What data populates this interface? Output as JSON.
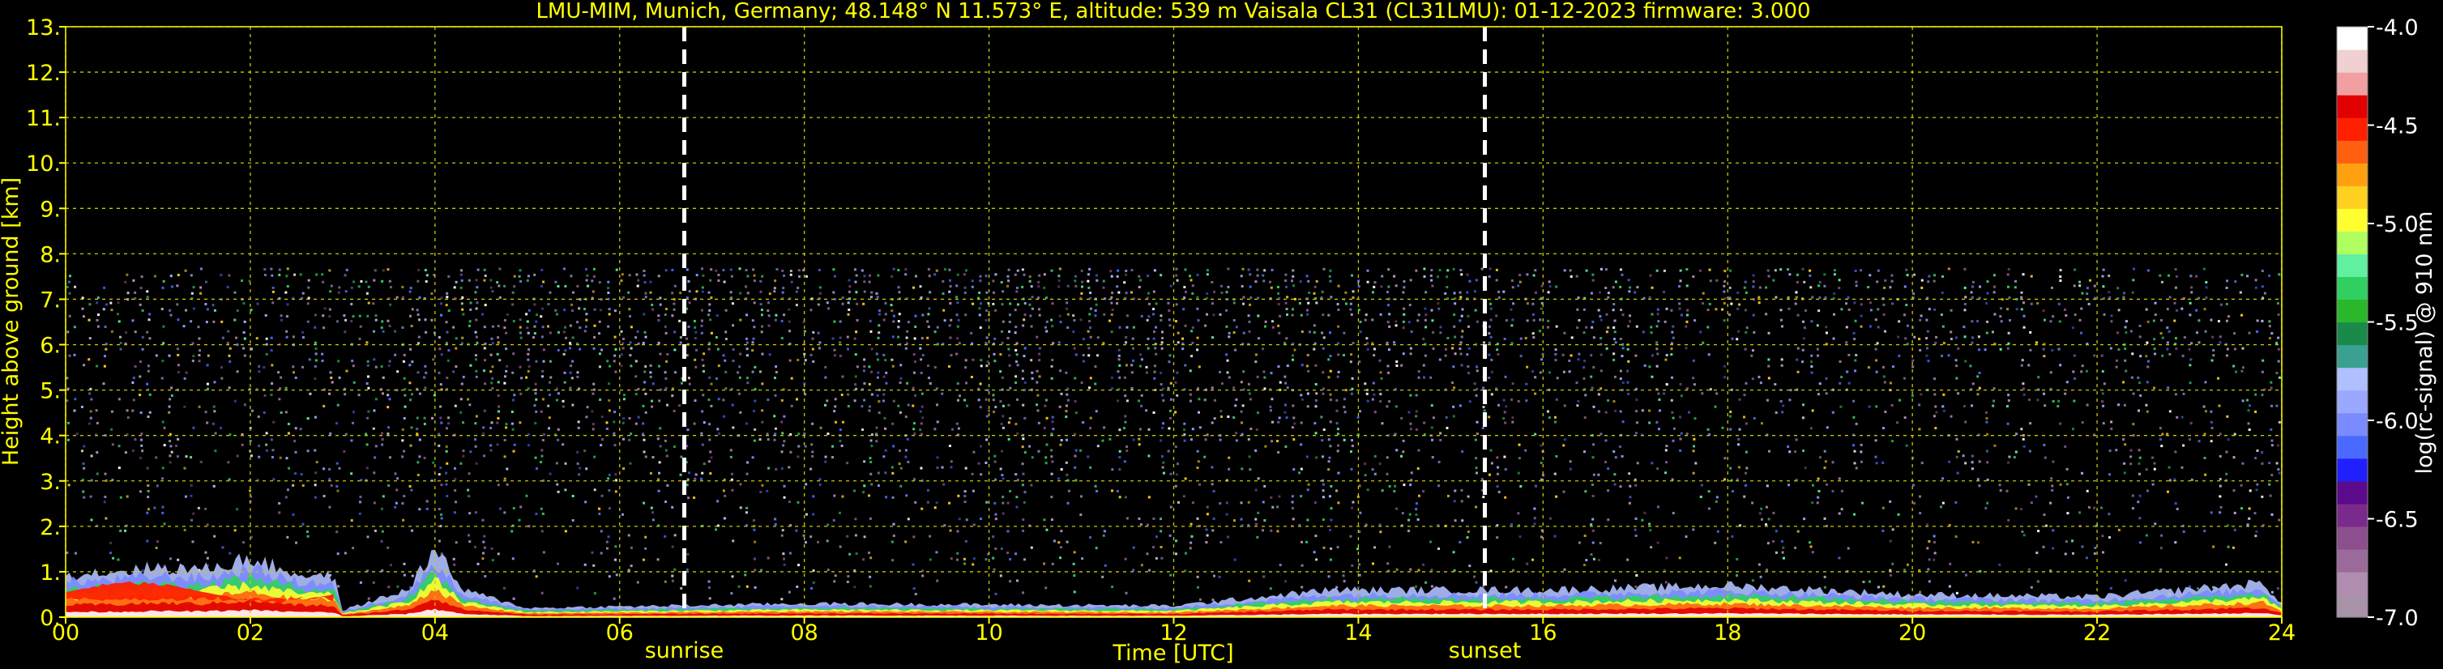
{
  "chart_data": {
    "type": "heatmap",
    "title": "LMU-MIM, Munich, Germany; 48.148° N 11.573° E, altitude: 539 m    Vaisala CL31 (CL31LMU): 01-12-2023    firmware: 3.000",
    "xlabel": "Time [UTC]",
    "ylabel": "Height above ground [km]",
    "colorbar_label": "log(rc-signal) @ 910 nm",
    "xlim": [
      0,
      24
    ],
    "ylim": [
      0,
      13
    ],
    "grid": true,
    "x_ticks": [
      0,
      2,
      4,
      6,
      8,
      10,
      12,
      14,
      16,
      18,
      20,
      22,
      24
    ],
    "x_tick_labels": [
      "00",
      "02",
      "04",
      "06",
      "08",
      "10",
      "12",
      "14",
      "16",
      "18",
      "20",
      "22",
      "24"
    ],
    "y_ticks": [
      0,
      1,
      2,
      3,
      4,
      5,
      6,
      7,
      8,
      9,
      10,
      11,
      12,
      13
    ],
    "y_tick_labels": [
      "0.",
      "1.",
      "2.",
      "3.",
      "4.",
      "5.",
      "6.",
      "7.",
      "8.",
      "9.",
      "10.",
      "11.",
      "12.",
      "13."
    ],
    "colorbar_range": [
      -7.0,
      -4.0
    ],
    "colorbar_ticks": [
      -7.0,
      -6.5,
      -6.0,
      -5.5,
      -5.0,
      -4.5,
      -4.0
    ],
    "colorbar_tick_labels": [
      "-7.0",
      "-6.5",
      "-6.0",
      "-5.5",
      "-5.0",
      "-4.5",
      "-4.0"
    ],
    "colormap": [
      "#a892a8",
      "#b08cb0",
      "#9a6a9a",
      "#8c4e8c",
      "#7a2a8a",
      "#5a0a8a",
      "#2020ff",
      "#4a6aff",
      "#7a8aff",
      "#9aa8ff",
      "#b0c0ff",
      "#3aa090",
      "#1a8a4a",
      "#2ab82a",
      "#30d060",
      "#60f0a0",
      "#b0ff60",
      "#ffff30",
      "#ffd020",
      "#ffa010",
      "#ff6010",
      "#ff2000",
      "#e00000",
      "#f0a0a0",
      "#f0d0d0",
      "#ffffff"
    ],
    "vertical_markers": [
      {
        "label": "sunrise",
        "x": 6.7
      },
      {
        "label": "sunset",
        "x": 15.37
      }
    ],
    "signal_top_km": 7.7,
    "boundary_layer": [
      {
        "t": 0.0,
        "top": 0.95
      },
      {
        "t": 0.5,
        "top": 1.0
      },
      {
        "t": 1.0,
        "top": 1.1
      },
      {
        "t": 1.5,
        "top": 1.05
      },
      {
        "t": 2.0,
        "top": 1.3
      },
      {
        "t": 2.5,
        "top": 0.95
      },
      {
        "t": 2.9,
        "top": 0.9
      },
      {
        "t": 3.0,
        "top": 0.15
      },
      {
        "t": 3.7,
        "top": 0.6
      },
      {
        "t": 4.0,
        "top": 1.5
      },
      {
        "t": 4.3,
        "top": 0.6
      },
      {
        "t": 5.0,
        "top": 0.2
      },
      {
        "t": 8.0,
        "top": 0.3
      },
      {
        "t": 12.0,
        "top": 0.25
      },
      {
        "t": 13.7,
        "top": 0.6
      },
      {
        "t": 16.0,
        "top": 0.6
      },
      {
        "t": 18.0,
        "top": 0.7
      },
      {
        "t": 20.0,
        "top": 0.5
      },
      {
        "t": 22.0,
        "top": 0.45
      },
      {
        "t": 23.8,
        "top": 0.75
      },
      {
        "t": 24.0,
        "top": 0.3
      }
    ],
    "colors": {
      "axis": "#ffff00",
      "grid": "#c8c800",
      "marker": "#ffffff",
      "background": "#000000"
    }
  }
}
